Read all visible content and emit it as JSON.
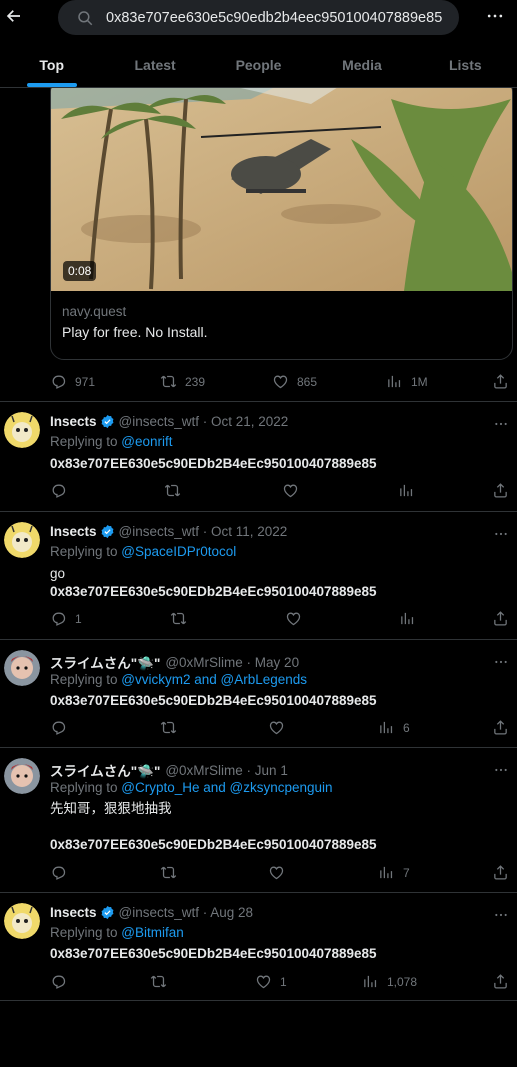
{
  "search": {
    "query": "0x83e707ee630e5c90edb2b4eec950100407889e85"
  },
  "tabs": [
    {
      "label": "Top"
    },
    {
      "label": "Latest"
    },
    {
      "label": "People"
    },
    {
      "label": "Media"
    },
    {
      "label": "Lists"
    }
  ],
  "card": {
    "duration": "0:08",
    "domain": "navy.quest",
    "title": "Play for free. No Install.",
    "replies": "971",
    "retweets": "239",
    "likes": "865",
    "views": "1M"
  },
  "tweets": [
    {
      "name": "Insects",
      "handle_date": "@insects_wtf · Oct 21, 2022",
      "replying_prefix": "Replying to ",
      "replying_to": "@eonrift",
      "line1": "0x83e707EE630e5c90EDb2B4eEc950100407889e85",
      "replies": "",
      "likes": "",
      "views": ""
    },
    {
      "name": "Insects",
      "handle_date": "@insects_wtf · Oct 11, 2022",
      "replying_prefix": "Replying to ",
      "replying_to": "@SpaceIDPr0tocol",
      "line1": "go",
      "line2": "0x83e707EE630e5c90EDb2B4eEc950100407889e85",
      "replies": "1",
      "likes": "",
      "views": ""
    },
    {
      "name": "スライムさん\"🛸\"",
      "handle_date": "@0xMrSlime · May 20",
      "replying_prefix": "Replying to ",
      "replying_to": "@vvickym2 and @ArbLegends",
      "line1": "0x83e707EE630e5c90EDb2B4eEc950100407889e85",
      "replies": "",
      "likes": "",
      "views": "6"
    },
    {
      "name": "スライムさん\"🛸\"",
      "handle_date": "@0xMrSlime · Jun 1",
      "replying_prefix": "Replying to ",
      "replying_to": "@Crypto_He and @zksyncpenguin",
      "line1": "先知哥，狠狠地抽我",
      "line2": "0x83e707EE630e5c90EDb2B4eEc950100407889e85",
      "replies": "",
      "likes": "",
      "views": "7"
    },
    {
      "name": "Insects",
      "handle_date": "@insects_wtf · Aug 28",
      "replying_prefix": "Replying to ",
      "replying_to": "@Bitmifan",
      "line1": "0x83e707EE630e5c90EDb2B4eEc950100407889e85",
      "replies": "",
      "likes": "1",
      "views": "1,078"
    }
  ],
  "colors": {
    "accent": "#1d9bf0",
    "muted": "#71767b",
    "text": "#e7e9ea",
    "border": "#2f3336"
  },
  "icons": [
    "back-arrow-icon",
    "search-icon",
    "more-icon",
    "reply-icon",
    "retweet-icon",
    "like-icon",
    "views-icon",
    "share-icon",
    "verified-icon"
  ]
}
